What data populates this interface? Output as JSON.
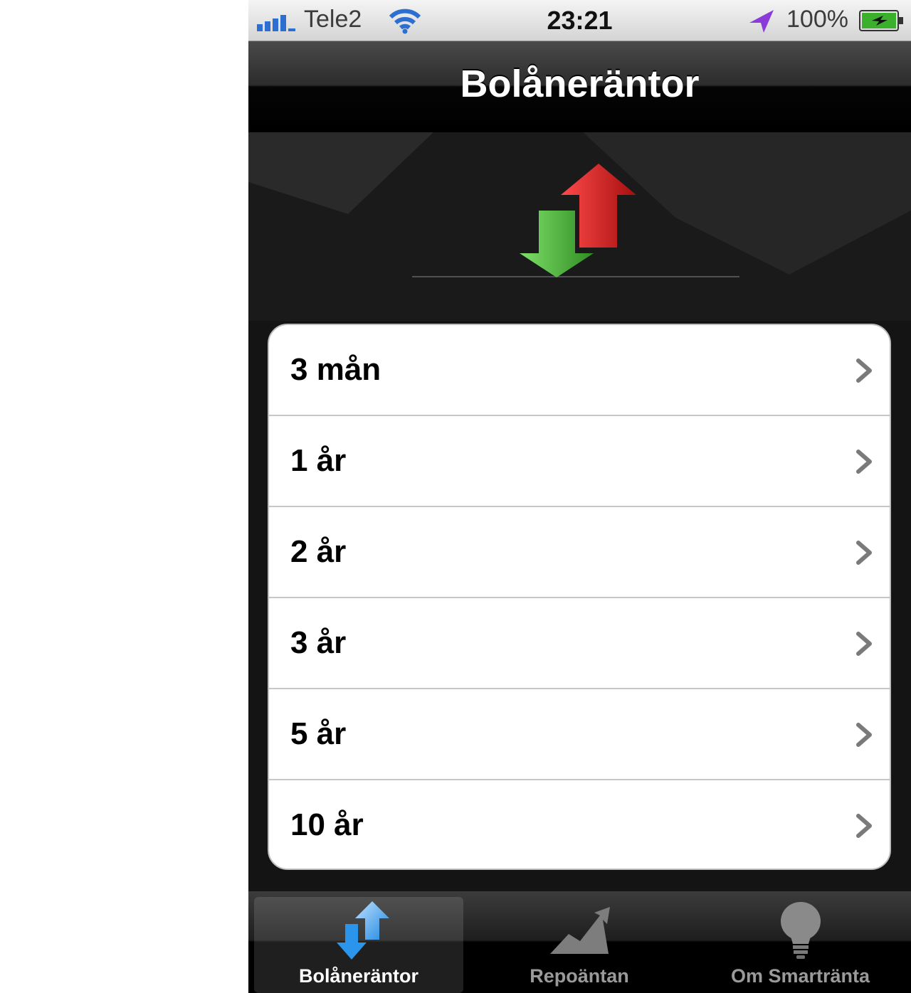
{
  "status_bar": {
    "carrier": "Tele2",
    "time": "23:21",
    "battery": "100%"
  },
  "nav": {
    "title": "Bolåneräntor"
  },
  "list": {
    "items": [
      {
        "label": "3 mån"
      },
      {
        "label": "1 år"
      },
      {
        "label": "2 år"
      },
      {
        "label": "3 år"
      },
      {
        "label": "5 år"
      },
      {
        "label": "10 år"
      }
    ]
  },
  "tab_bar": {
    "tabs": [
      {
        "label": "Bolåneräntor",
        "icon": "blue-up-down-arrows-icon",
        "selected": true
      },
      {
        "label": "Repoäntan",
        "icon": "rising-chart-icon",
        "selected": false
      },
      {
        "label": "Om Smartränta",
        "icon": "lightbulb-icon",
        "selected": false
      }
    ]
  },
  "colors": {
    "up_arrow": "#d62020",
    "down_arrow": "#4cb63a",
    "tab_arrows": "#3a9be8"
  }
}
